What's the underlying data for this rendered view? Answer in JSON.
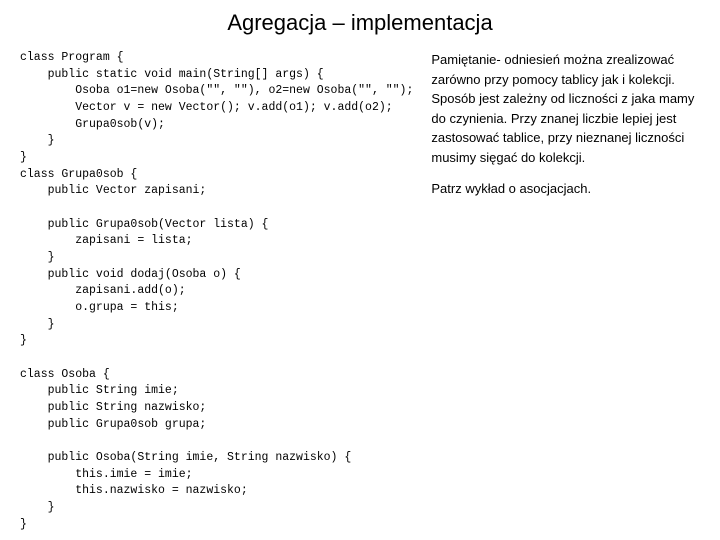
{
  "title": "Agregacja – implementacja",
  "code": "class Program {\n    public static void main(String[] args) {\n        Osoba o1=new Osoba(\"\", \"\"), o2=new Osoba(\"\", \"\");\n        Vector v = new Vector(); v.add(o1); v.add(o2);\n        Grupa0sob(v);\n    }\n}\nclass Grupa0sob {\n    public Vector zapisani;\n\n    public Grupa0sob(Vector lista) {\n        zapisani = lista;\n    }\n    public void dodaj(Osoba o) {\n        zapisani.add(o);\n        o.grupa = this;\n    }\n}\n\nclass Osoba {\n    public String imie;\n    public String nazwisko;\n    public Grupa0sob grupa;\n\n    public Osoba(String imie, String nazwisko) {\n        this.imie = imie;\n        this.nazwisko = nazwisko;\n    }\n}",
  "text_paragraph1": "Pamiętanie- odniesień można zrealizować zarówno przy pomocy tablicy jak i kolekcji. Sposób jest zależny od liczności z jaka mamy do czynienia. Przy znanej liczbie lepiej jest zastosować tablice, przy nieznanej liczności musimy sięgać do kolekcji.",
  "text_paragraph2": "Patrz wykład o asocjacjach."
}
